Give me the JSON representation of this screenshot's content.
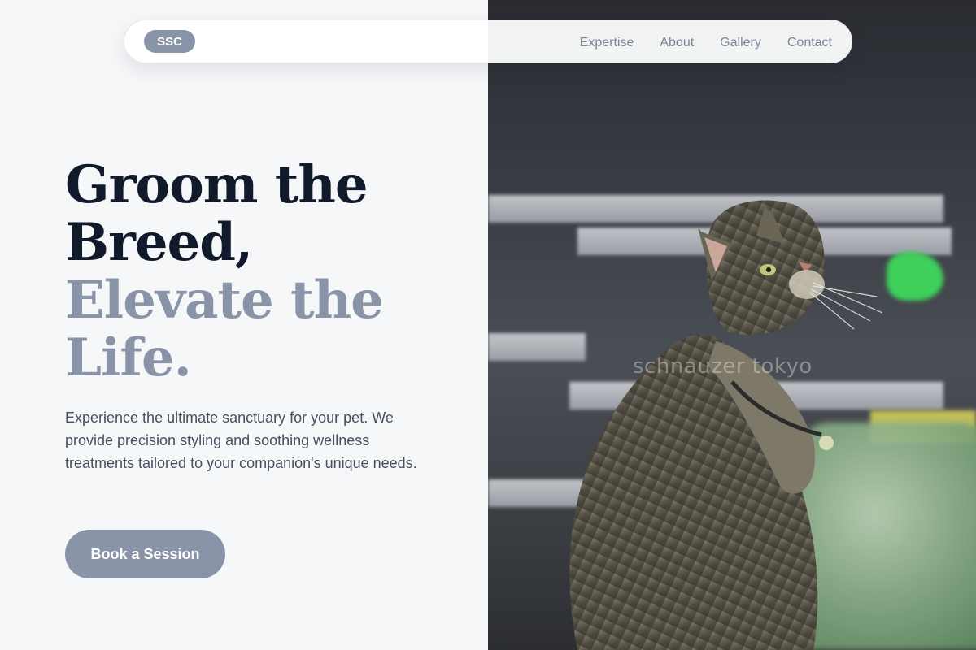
{
  "nav": {
    "logo": "SSC",
    "links": [
      {
        "label": "Expertise"
      },
      {
        "label": "About"
      },
      {
        "label": "Gallery"
      },
      {
        "label": "Contact"
      }
    ]
  },
  "hero": {
    "headline_line1": "Groom the",
    "headline_line2": "Breed,",
    "headline_line3": "Elevate the",
    "headline_line4": "Life.",
    "description": "Experience the ultimate sanctuary for your pet. We provide precision styling and soothing wellness treatments tailored to your companion's unique needs.",
    "cta_label": "Book a Session"
  },
  "image": {
    "subject": "tabby cat sitting in pet store aisle looking up",
    "watermark": "schnauzer tokyo"
  },
  "colors": {
    "heading_dark": "#111a2b",
    "heading_muted": "#8a94a8",
    "accent": "#8a94a8",
    "body_text": "#45505f",
    "background": "#f6f7f9"
  }
}
